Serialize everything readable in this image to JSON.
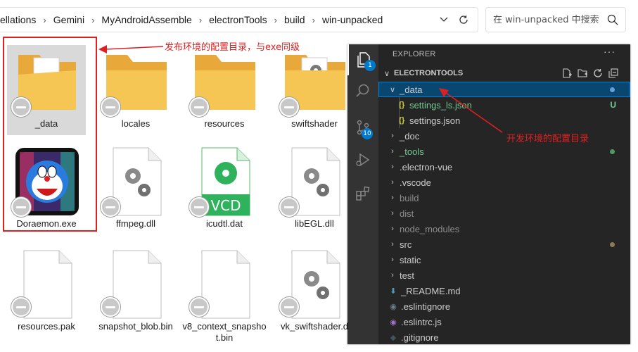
{
  "breadcrumbs": [
    "ellations",
    "Gemini",
    "MyAndroidAssemble",
    "electronTools",
    "build",
    "win-unpacked"
  ],
  "search": {
    "placeholder": "在 win-unpacked 中搜索"
  },
  "files": [
    {
      "name": "_data",
      "type": "folder",
      "selected": true
    },
    {
      "name": "locales",
      "type": "folder"
    },
    {
      "name": "resources",
      "type": "folder"
    },
    {
      "name": "swiftshader",
      "type": "folder-gear"
    },
    {
      "name": "Doraemon.exe",
      "type": "exe"
    },
    {
      "name": "ffmpeg.dll",
      "type": "dll"
    },
    {
      "name": "icudtl.dat",
      "type": "vcd",
      "icon_text": "VCD"
    },
    {
      "name": "libEGL.dll",
      "type": "dll"
    },
    {
      "name": "resources.pak",
      "type": "blank"
    },
    {
      "name": "snapshot_blob.bin",
      "type": "blank"
    },
    {
      "name": "v8_context_snapshot.bin",
      "type": "blank"
    },
    {
      "name": "vk_swiftshader.d",
      "type": "dll"
    }
  ],
  "annotations": {
    "release_config": "发布环境的配置目录，与exe同级",
    "dev_config": "开发环境的配置目录"
  },
  "vscode": {
    "explorer_title": "EXPLORER",
    "more_actions": "···",
    "section_title": "ELECTRONTOOLS",
    "badges": {
      "explorer": "1",
      "source_control": "10"
    },
    "tree": [
      {
        "name": "_data",
        "kind": "folder-open",
        "selected": true,
        "dot": "#6a9dd8"
      },
      {
        "name": "settings_ls.json",
        "kind": "json",
        "indent": 1,
        "status": "U",
        "color": "#73c991"
      },
      {
        "name": "settings.json",
        "kind": "json",
        "indent": 1
      },
      {
        "name": "_doc",
        "kind": "folder"
      },
      {
        "name": "_tools",
        "kind": "folder",
        "color": "#73c991",
        "dot": "#4e9a60"
      },
      {
        "name": ".electron-vue",
        "kind": "folder"
      },
      {
        "name": ".vscode",
        "kind": "folder"
      },
      {
        "name": "build",
        "kind": "folder",
        "color": "#8c8c8c"
      },
      {
        "name": "dist",
        "kind": "folder",
        "color": "#8c8c8c"
      },
      {
        "name": "node_modules",
        "kind": "folder",
        "color": "#8c8c8c"
      },
      {
        "name": "src",
        "kind": "folder",
        "dot": "#8c7a54"
      },
      {
        "name": "static",
        "kind": "folder"
      },
      {
        "name": "test",
        "kind": "folder"
      },
      {
        "name": "_README.md",
        "kind": "md"
      },
      {
        "name": ".eslintignore",
        "kind": "eslintignore"
      },
      {
        "name": ".eslintrc.js",
        "kind": "eslintrc"
      },
      {
        "name": ".gitignore",
        "kind": "gitignore"
      }
    ]
  },
  "colors": {
    "annotation_red": "#e02020",
    "vscode_sidebar": "#252526",
    "vscode_activity": "#333333",
    "folder_yellow": "#f4c04f",
    "accent_blue": "#007acc",
    "untracked_green": "#73c991"
  }
}
